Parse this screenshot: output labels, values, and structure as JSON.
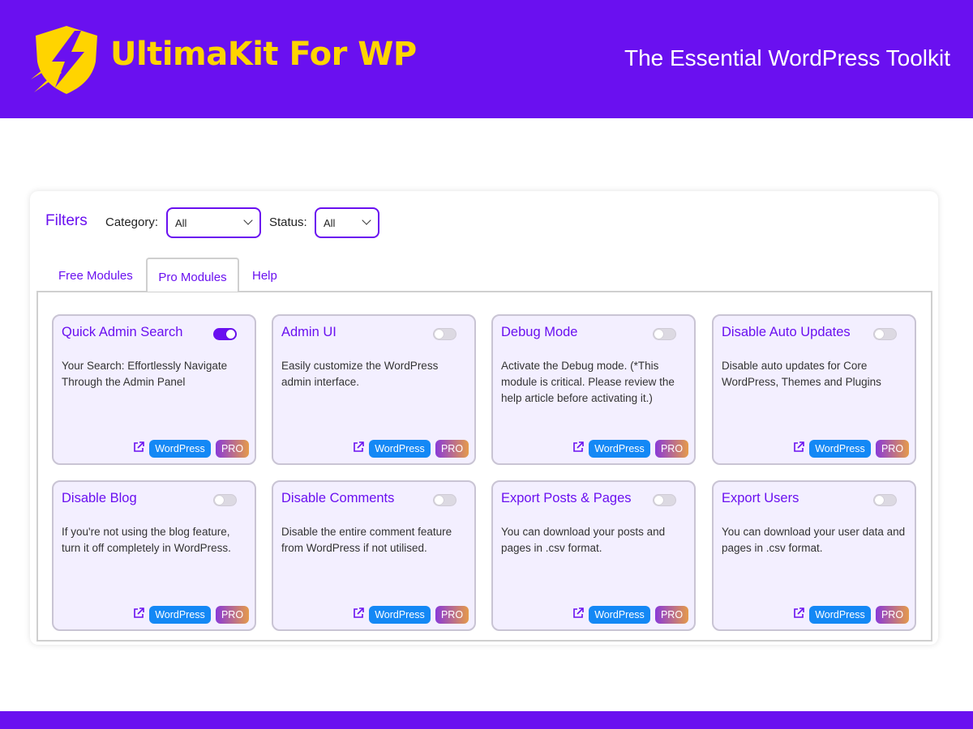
{
  "header": {
    "brand": "UltimaKit For WP",
    "tagline": "The Essential WordPress Toolkit",
    "logo_icon": "shield-lightning-icon"
  },
  "filters": {
    "title": "Filters",
    "category_label": "Category:",
    "category_value": "All",
    "status_label": "Status:",
    "status_value": "All"
  },
  "tabs": [
    {
      "label": "Free Modules",
      "active": false
    },
    {
      "label": "Pro Modules",
      "active": true
    },
    {
      "label": "Help",
      "active": false
    }
  ],
  "modules": [
    {
      "title": "Quick Admin Search",
      "description": "Your Search: Effortlessly Navigate Through the Admin Panel",
      "enabled": true,
      "badge_wp": "WordPress",
      "badge_pro": "PRO"
    },
    {
      "title": "Admin UI",
      "description": "Easily customize the WordPress admin interface.",
      "enabled": false,
      "badge_wp": "WordPress",
      "badge_pro": "PRO"
    },
    {
      "title": "Debug Mode",
      "description": "Activate the Debug mode. (*This module is critical. Please review the help article before activating it.)",
      "enabled": false,
      "badge_wp": "WordPress",
      "badge_pro": "PRO"
    },
    {
      "title": "Disable Auto Updates",
      "description": "Disable auto updates for Core WordPress, Themes and Plugins",
      "enabled": false,
      "badge_wp": "WordPress",
      "badge_pro": "PRO"
    },
    {
      "title": "Disable Blog",
      "description": "If you're not using the blog feature, turn it off completely in WordPress.",
      "enabled": false,
      "badge_wp": "WordPress",
      "badge_pro": "PRO"
    },
    {
      "title": "Disable Comments",
      "description": "Disable the entire comment feature from WordPress if not utilised.",
      "enabled": false,
      "badge_wp": "WordPress",
      "badge_pro": "PRO"
    },
    {
      "title": "Export Posts & Pages",
      "description": "You can download your posts and pages in .csv format.",
      "enabled": false,
      "badge_wp": "WordPress",
      "badge_pro": "PRO"
    },
    {
      "title": "Export Users",
      "description": "You can download your user data and pages in .csv format.",
      "enabled": false,
      "badge_wp": "WordPress",
      "badge_pro": "PRO"
    }
  ],
  "colors": {
    "accent": "#6a10f0",
    "brand_yellow": "#ffd400",
    "badge_wordpress": "#1488f5",
    "card_bg": "#f3efff"
  }
}
